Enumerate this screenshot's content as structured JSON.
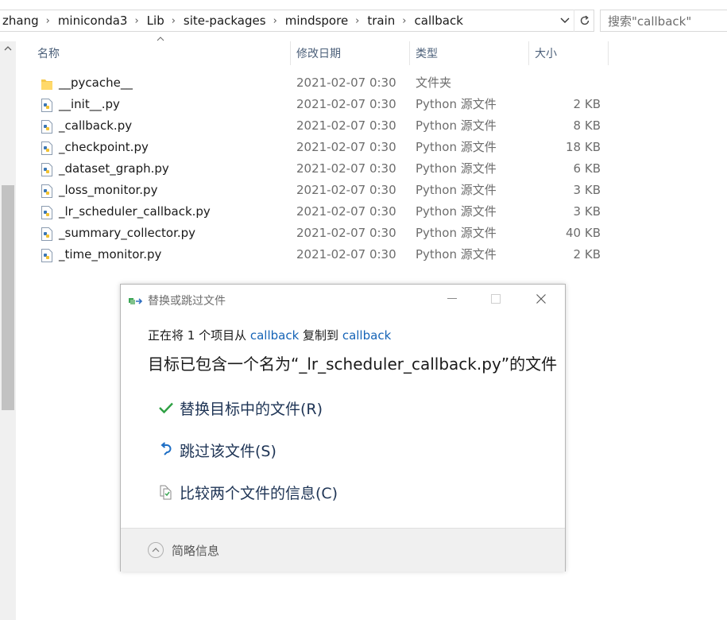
{
  "address": {
    "path": [
      "zhang",
      "miniconda3",
      "Lib",
      "site-packages",
      "mindspore",
      "train",
      "callback"
    ],
    "dropdown_icon": "chevron-down-icon",
    "refresh_icon": "refresh-icon"
  },
  "search": {
    "placeholder": "搜索\"callback\""
  },
  "columns": {
    "name": "名称",
    "date": "修改日期",
    "type": "类型",
    "size": "大小"
  },
  "files": [
    {
      "name": "__pycache__",
      "date": "2021-02-07 0:30",
      "type": "文件夹",
      "size": "",
      "icon": "folder-icon"
    },
    {
      "name": "__init__.py",
      "date": "2021-02-07 0:30",
      "type": "Python 源文件",
      "size": "2 KB",
      "icon": "python-file-icon"
    },
    {
      "name": "_callback.py",
      "date": "2021-02-07 0:30",
      "type": "Python 源文件",
      "size": "8 KB",
      "icon": "python-file-icon"
    },
    {
      "name": "_checkpoint.py",
      "date": "2021-02-07 0:30",
      "type": "Python 源文件",
      "size": "18 KB",
      "icon": "python-file-icon"
    },
    {
      "name": "_dataset_graph.py",
      "date": "2021-02-07 0:30",
      "type": "Python 源文件",
      "size": "6 KB",
      "icon": "python-file-icon"
    },
    {
      "name": "_loss_monitor.py",
      "date": "2021-02-07 0:30",
      "type": "Python 源文件",
      "size": "3 KB",
      "icon": "python-file-icon"
    },
    {
      "name": "_lr_scheduler_callback.py",
      "date": "2021-02-07 0:30",
      "type": "Python 源文件",
      "size": "3 KB",
      "icon": "python-file-icon"
    },
    {
      "name": "_summary_collector.py",
      "date": "2021-02-07 0:30",
      "type": "Python 源文件",
      "size": "40 KB",
      "icon": "python-file-icon"
    },
    {
      "name": "_time_monitor.py",
      "date": "2021-02-07 0:30",
      "type": "Python 源文件",
      "size": "2 KB",
      "icon": "python-file-icon"
    }
  ],
  "dialog": {
    "title": "替换或跳过文件",
    "line1_pre": "正在将 1 个项目从 ",
    "source": "callback",
    "line1_mid": " 复制到 ",
    "dest": "callback",
    "message": "目标已包含一个名为“_lr_scheduler_callback.py”的文件",
    "options": [
      {
        "label": "替换目标中的文件(R)",
        "icon": "checkmark-icon"
      },
      {
        "label": "跳过该文件(S)",
        "icon": "skip-arrow-icon"
      },
      {
        "label": "比较两个文件的信息(C)",
        "icon": "compare-files-icon"
      }
    ],
    "footer_label": "简略信息"
  },
  "colors": {
    "link": "#1664b7",
    "option_text": "#1e3455",
    "check_green": "#2ea043",
    "skip_blue": "#1f6fc5"
  }
}
